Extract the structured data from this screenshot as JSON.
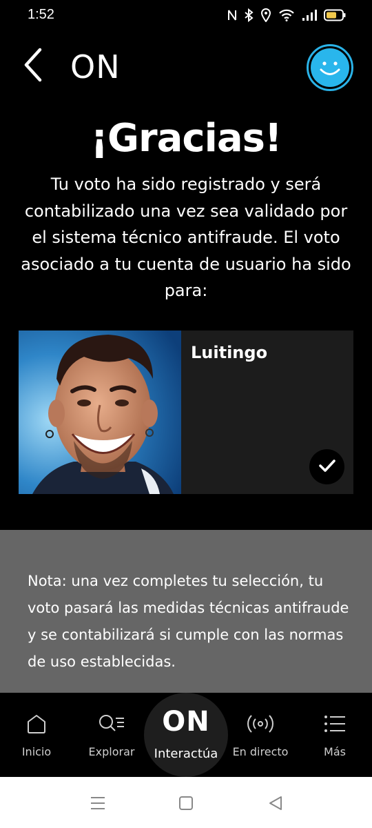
{
  "status_bar": {
    "time": "1:52",
    "icons": [
      "nfc-icon",
      "bluetooth-icon",
      "location-icon",
      "wifi-icon",
      "signal-icon",
      "battery-icon"
    ]
  },
  "header": {
    "title": "ON",
    "back_icon": "chevron-left-icon",
    "avatar_icon": "smiley-icon",
    "accent_color": "#29b6ec"
  },
  "thanks": {
    "title": "¡Gracias!",
    "lines": [
      "Tu voto ha sido registrado y será",
      "contabilizado una vez sea validado por",
      "el sistema técnico antifraude. El voto",
      "asociado a tu cuenta de usuario ha sido",
      "para:"
    ]
  },
  "candidate": {
    "name": "Luitingo",
    "selected": true,
    "check_icon": "checkmark-icon"
  },
  "note": {
    "lines": [
      "Nota: una vez completes tu selección, tu",
      "voto pasará las medidas técnicas antifraude",
      "y se contabilizará si cumple con las normas",
      "de uso establecidas."
    ]
  },
  "bottom_nav": {
    "items": [
      {
        "label": "Inicio",
        "icon": "home-icon"
      },
      {
        "label": "Explorar",
        "icon": "search-list-icon"
      },
      {
        "label": "Interactúa",
        "icon": "on-logo-icon",
        "logo": "ON",
        "active": true
      },
      {
        "label": "En directo",
        "icon": "broadcast-icon"
      },
      {
        "label": "Más",
        "icon": "menu-list-icon"
      }
    ]
  },
  "system_nav": {
    "icons": [
      "recent-apps-icon",
      "home-square-icon",
      "back-triangle-icon"
    ]
  }
}
